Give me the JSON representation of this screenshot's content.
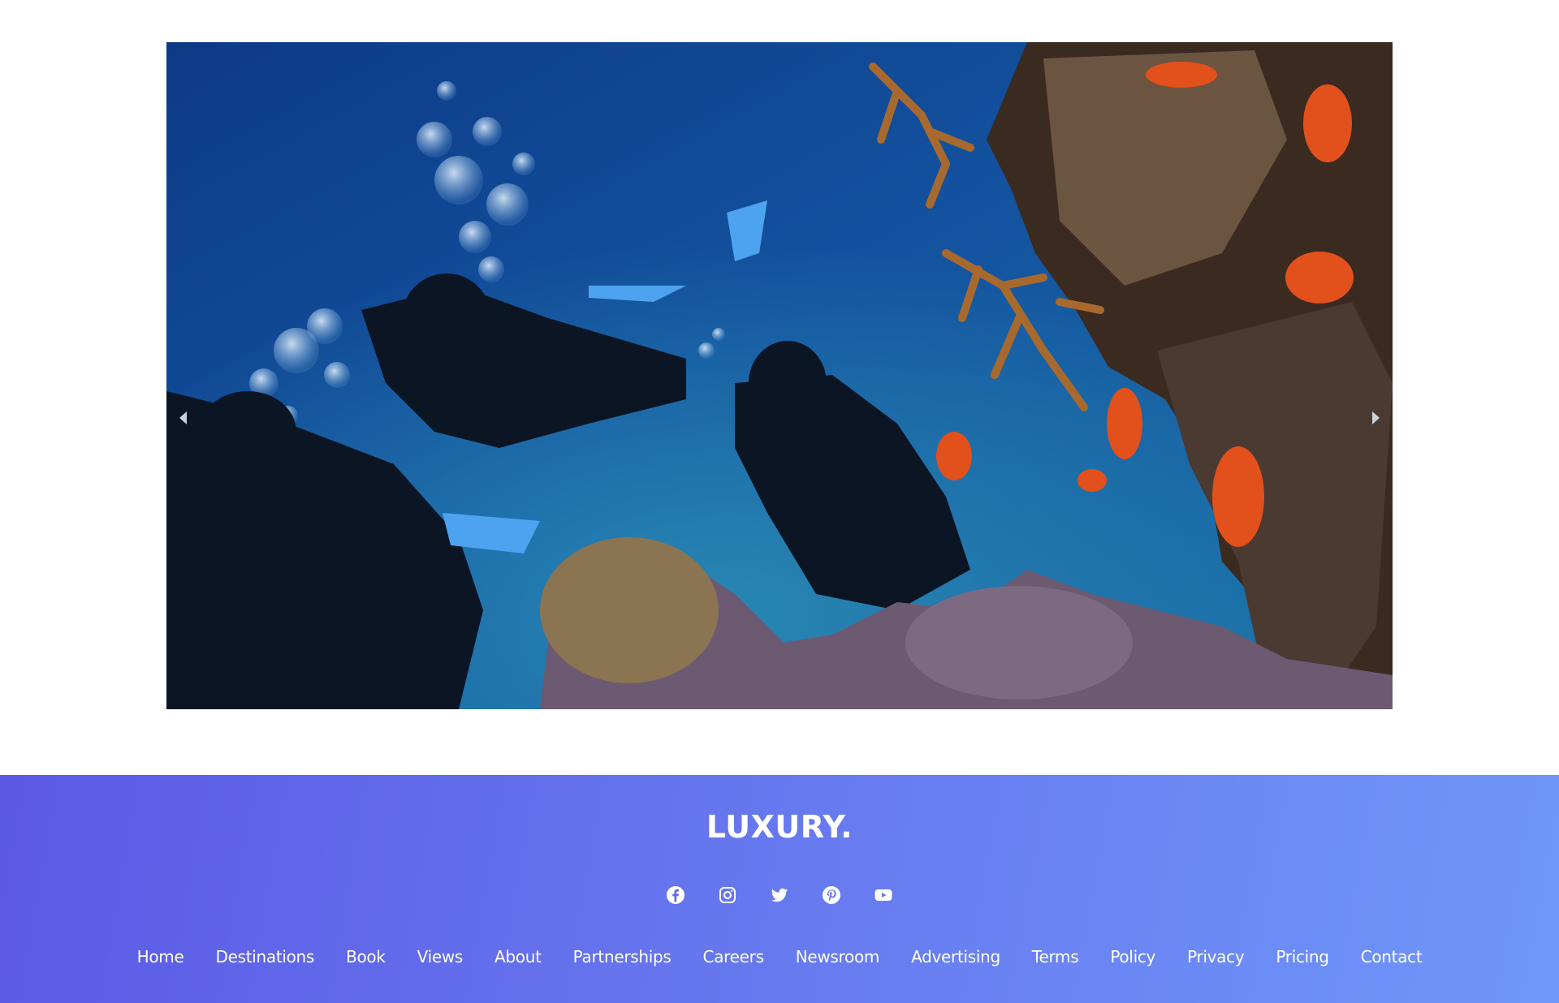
{
  "slider": {
    "photo_alt": "Scuba divers swimming near a coral reef with orange fish",
    "prev_icon": "chevron-left-icon",
    "next_icon": "chevron-right-icon"
  },
  "footer": {
    "brand": "LUXURY.",
    "socials": [
      {
        "icon": "facebook-icon"
      },
      {
        "icon": "instagram-icon"
      },
      {
        "icon": "twitter-icon"
      },
      {
        "icon": "pinterest-icon"
      },
      {
        "icon": "youtube-icon"
      }
    ],
    "nav": [
      {
        "label": "Home"
      },
      {
        "label": "Destinations"
      },
      {
        "label": "Book"
      },
      {
        "label": "Views"
      },
      {
        "label": "About"
      },
      {
        "label": "Partnerships"
      },
      {
        "label": "Careers"
      },
      {
        "label": "Newsroom"
      },
      {
        "label": "Advertising"
      },
      {
        "label": "Terms"
      },
      {
        "label": "Policy"
      },
      {
        "label": "Privacy"
      },
      {
        "label": "Pricing"
      },
      {
        "label": "Contact"
      }
    ],
    "gradient_start": "#5b59e6",
    "gradient_end": "#6f97fa"
  }
}
